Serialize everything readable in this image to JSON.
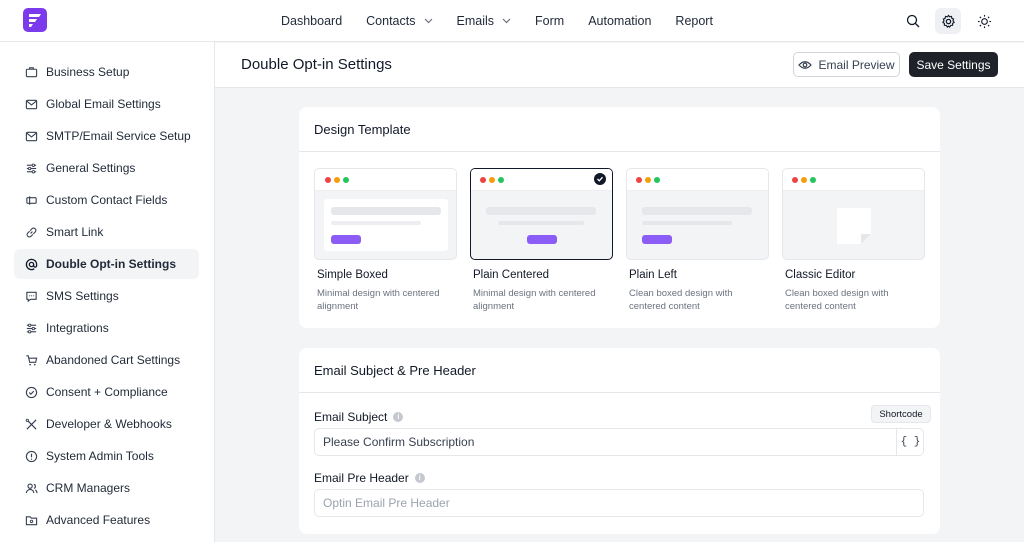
{
  "nav": {
    "items": [
      {
        "label": "Dashboard",
        "has_dropdown": false
      },
      {
        "label": "Contacts",
        "has_dropdown": true
      },
      {
        "label": "Emails",
        "has_dropdown": true
      },
      {
        "label": "Form",
        "has_dropdown": false
      },
      {
        "label": "Automation",
        "has_dropdown": false
      },
      {
        "label": "Report",
        "has_dropdown": false
      }
    ],
    "icons": [
      "search-icon",
      "settings-icon",
      "sun-icon"
    ]
  },
  "sidebar": {
    "items": [
      {
        "label": "Business Setup",
        "icon": "briefcase-icon",
        "active": false
      },
      {
        "label": "Global Email Settings",
        "icon": "mail-check-icon",
        "active": false
      },
      {
        "label": "SMTP/Email Service Setup",
        "icon": "mail-icon",
        "active": false
      },
      {
        "label": "General Settings",
        "icon": "sliders-icon",
        "active": false
      },
      {
        "label": "Custom Contact Fields",
        "icon": "form-icon",
        "active": false
      },
      {
        "label": "Smart Link",
        "icon": "link-icon",
        "active": false
      },
      {
        "label": "Double Opt-in Settings",
        "icon": "at-icon",
        "active": true
      },
      {
        "label": "SMS Settings",
        "icon": "chat-icon",
        "active": false
      },
      {
        "label": "Integrations",
        "icon": "sliders-icon",
        "active": false
      },
      {
        "label": "Abandoned Cart Settings",
        "icon": "cart-icon",
        "active": false
      },
      {
        "label": "Consent + Compliance",
        "icon": "check-circle-icon",
        "active": false
      },
      {
        "label": "Developer & Webhooks",
        "icon": "tools-icon",
        "active": false
      },
      {
        "label": "System Admin Tools",
        "icon": "alert-circle-icon",
        "active": false
      },
      {
        "label": "CRM Managers",
        "icon": "users-icon",
        "active": false
      },
      {
        "label": "Advanced Features",
        "icon": "folder-icon",
        "active": false
      }
    ]
  },
  "header": {
    "title": "Double Opt-in Settings",
    "preview_label": "Email Preview",
    "save_label": "Save Settings"
  },
  "design": {
    "title": "Design Template",
    "templates": [
      {
        "name": "Simple Boxed",
        "desc": "Minimal design with centered alignment",
        "selected": false
      },
      {
        "name": "Plain Centered",
        "desc": "Minimal design with centered alignment",
        "selected": true
      },
      {
        "name": "Plain Left",
        "desc": "Clean boxed design with centered content",
        "selected": false
      },
      {
        "name": "Classic Editor",
        "desc": "Clean boxed design with centered content",
        "selected": false
      }
    ]
  },
  "subject": {
    "title": "Email Subject & Pre Header",
    "subject_label": "Email Subject",
    "subject_value": "Please Confirm Subscription",
    "shortcode_tooltip": "Shortcode",
    "shortcode_btn": "{ }",
    "preheader_label": "Email Pre Header",
    "preheader_placeholder": "Optin Email Pre Header"
  },
  "colors": {
    "brand": "#7c3aed",
    "save_button": "#1f2329",
    "dot_red": "#ef4444",
    "dot_yellow": "#f59e0b",
    "dot_green": "#22c55e"
  }
}
